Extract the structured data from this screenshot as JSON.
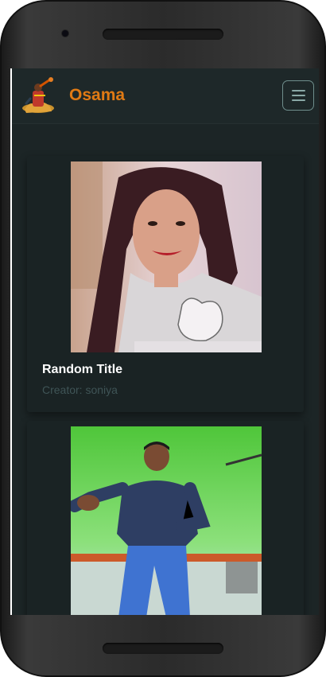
{
  "navbar": {
    "brand_name": "Osama"
  },
  "cards": [
    {
      "title": "Random Title",
      "creator": "Creator: soniya"
    },
    {
      "title": "",
      "creator": ""
    }
  ],
  "colors": {
    "screen_bg": "#1c2526",
    "brand": "#e07a14",
    "title": "#ffffff",
    "creator": "#3f5456",
    "toggle_border": "#6f8e8c"
  },
  "icons": {
    "menu": "hamburger-icon",
    "logo": "brand-logo-icon"
  }
}
